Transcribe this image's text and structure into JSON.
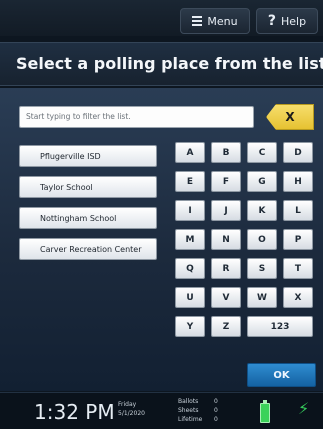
{
  "topbar": {
    "menu_label": "Menu",
    "help_label": "Help"
  },
  "title": "Select a polling place from the list",
  "filter": {
    "placeholder": "Start typing to filter the list."
  },
  "clear_label": "X",
  "locations": [
    {
      "label": "Pflugerville ISD"
    },
    {
      "label": "Taylor School"
    },
    {
      "label": "Nottingham School"
    },
    {
      "label": "Carver Recreation Center"
    }
  ],
  "keyboard": {
    "row1": [
      "A",
      "B",
      "C",
      "D"
    ],
    "row2": [
      "E",
      "F",
      "G",
      "H"
    ],
    "row3": [
      "I",
      "J",
      "K",
      "L"
    ],
    "row4": [
      "M",
      "N",
      "O",
      "P"
    ],
    "row5": [
      "Q",
      "R",
      "S",
      "T"
    ],
    "row6": [
      "U",
      "V",
      "W",
      "X"
    ],
    "row7": [
      "Y",
      "Z",
      "123"
    ]
  },
  "ok_label": "OK",
  "status": {
    "time": "1:32 PM",
    "day": "Friday",
    "date": "5/1/2020",
    "counts": [
      {
        "label": "Ballots",
        "value": "0"
      },
      {
        "label": "Sheets",
        "value": "0"
      },
      {
        "label": "Lifetime",
        "value": "0"
      }
    ]
  },
  "colors": {
    "accent": "#1e78c2",
    "clear": "#efd24a",
    "battery": "#3bd25a"
  },
  "icons": [
    "menu-icon",
    "help-icon",
    "battery-icon",
    "plug-icon"
  ]
}
